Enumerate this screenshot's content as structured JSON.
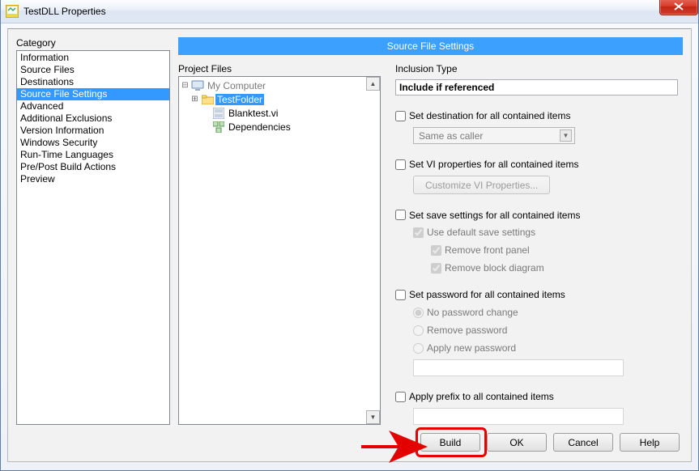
{
  "window": {
    "title": "TestDLL Properties"
  },
  "category": {
    "label": "Category",
    "items": [
      "Information",
      "Source Files",
      "Destinations",
      "Source File Settings",
      "Advanced",
      "Additional Exclusions",
      "Version Information",
      "Windows Security",
      "Run-Time Languages",
      "Pre/Post Build Actions",
      "Preview"
    ],
    "selected_index": 3
  },
  "right": {
    "header": "Source File Settings",
    "tree": {
      "label": "Project Files",
      "root": "My Computer",
      "items": [
        {
          "label": "TestFolder",
          "kind": "folder",
          "selected": true
        },
        {
          "label": "Blanktest.vi",
          "kind": "vi",
          "selected": false
        },
        {
          "label": "Dependencies",
          "kind": "dep",
          "selected": false
        }
      ]
    },
    "settings": {
      "inclusion_label": "Inclusion Type",
      "inclusion_value": "Include if referenced",
      "set_dest": "Set destination for all contained items",
      "dest_combo": "Same as caller",
      "set_vi_props": "Set VI properties for all contained items",
      "customize_btn": "Customize VI Properties...",
      "set_save": "Set save settings for all contained items",
      "use_default_save": "Use default save settings",
      "remove_front": "Remove front panel",
      "remove_block": "Remove block diagram",
      "set_password": "Set password for all contained items",
      "pw_no_change": "No password change",
      "pw_remove": "Remove password",
      "pw_apply_new": "Apply new password",
      "apply_prefix": "Apply prefix to all contained items"
    }
  },
  "buttons": {
    "build": "Build",
    "ok": "OK",
    "cancel": "Cancel",
    "help": "Help"
  }
}
